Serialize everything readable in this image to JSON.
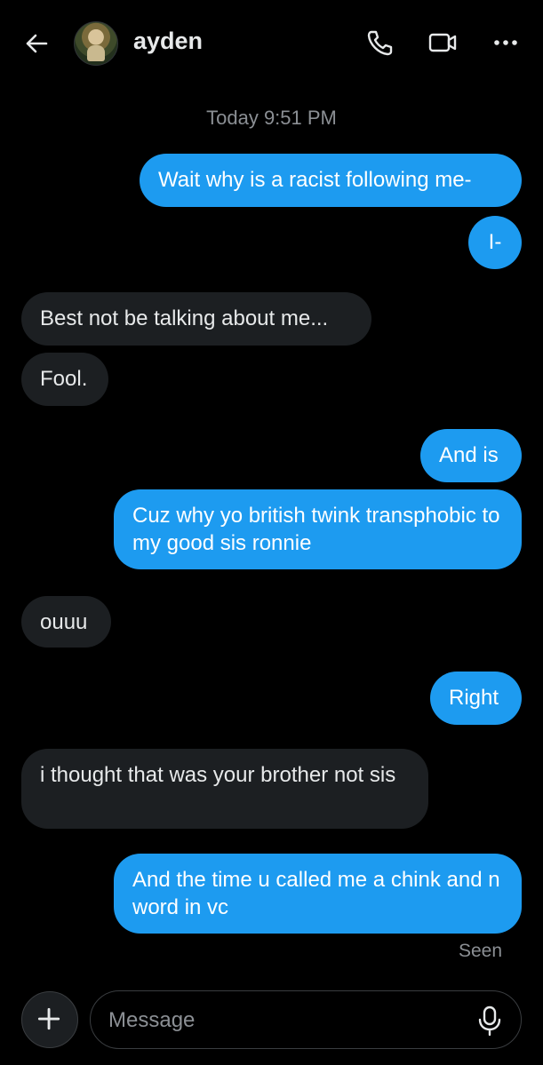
{
  "header": {
    "contact_name": "ayden",
    "icons": [
      "back-arrow-icon",
      "phone-icon",
      "video-icon",
      "more-icon"
    ]
  },
  "conversation": {
    "timestamp": "Today 9:51 PM",
    "messages": [
      {
        "direction": "out",
        "text": "Wait why is a racist following me-"
      },
      {
        "direction": "out",
        "text": "I-"
      },
      {
        "direction": "in",
        "text": "Best not be talking about me..."
      },
      {
        "direction": "in",
        "text": "Fool."
      },
      {
        "direction": "out",
        "text": "And is"
      },
      {
        "direction": "out",
        "text": "Cuz why yo british twink transphobic to my good sis ronnie"
      },
      {
        "direction": "in",
        "text": "ouuu"
      },
      {
        "direction": "out",
        "text": "Right"
      },
      {
        "direction": "in",
        "text": "i thought that was your brother not sis"
      },
      {
        "direction": "out",
        "text": "And the time u called me a chink and n word in vc"
      }
    ],
    "seen_label": "Seen"
  },
  "composer": {
    "placeholder": "Message",
    "value": "",
    "icons": [
      "plus-icon",
      "microphone-icon"
    ]
  },
  "colors": {
    "background": "#000000",
    "outgoing_bubble": "#1d9bf0",
    "incoming_bubble": "#1c1f22",
    "muted_text": "#8b8f94"
  }
}
